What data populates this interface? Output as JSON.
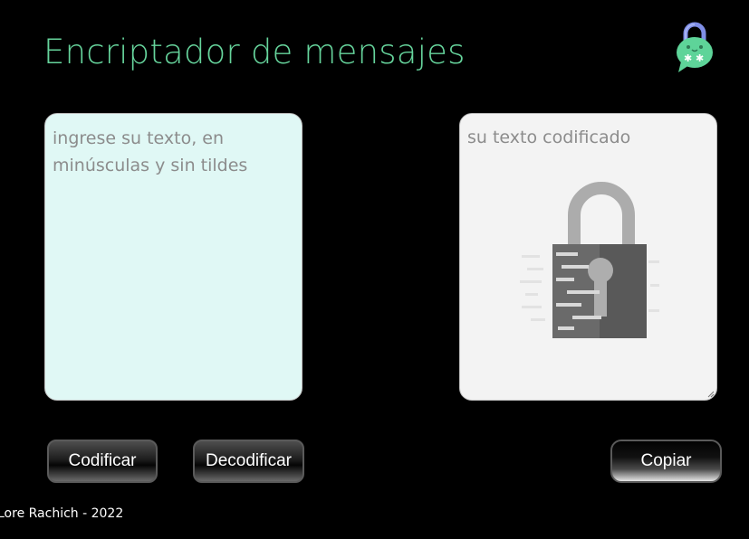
{
  "header": {
    "title": "Encriptador de mensajes",
    "logo_icon": "chat-lock-icon"
  },
  "input": {
    "placeholder": "ingrese su texto, en minúsculas y sin tildes",
    "value": ""
  },
  "output": {
    "placeholder_text": "su texto codificado",
    "illustration_icon": "padlock-icon"
  },
  "buttons": {
    "encrypt_label": "Codificar",
    "decrypt_label": "Decodificar",
    "copy_label": "Copiar"
  },
  "footer": {
    "credit": "Lore Rachich - 2022"
  },
  "colors": {
    "background": "#000000",
    "title": "#66d49c",
    "input_bg": "#e0f8f5",
    "output_bg": "#f3f3f3",
    "logo_green": "#5ed499",
    "logo_shackle": "#7f8ee6"
  }
}
